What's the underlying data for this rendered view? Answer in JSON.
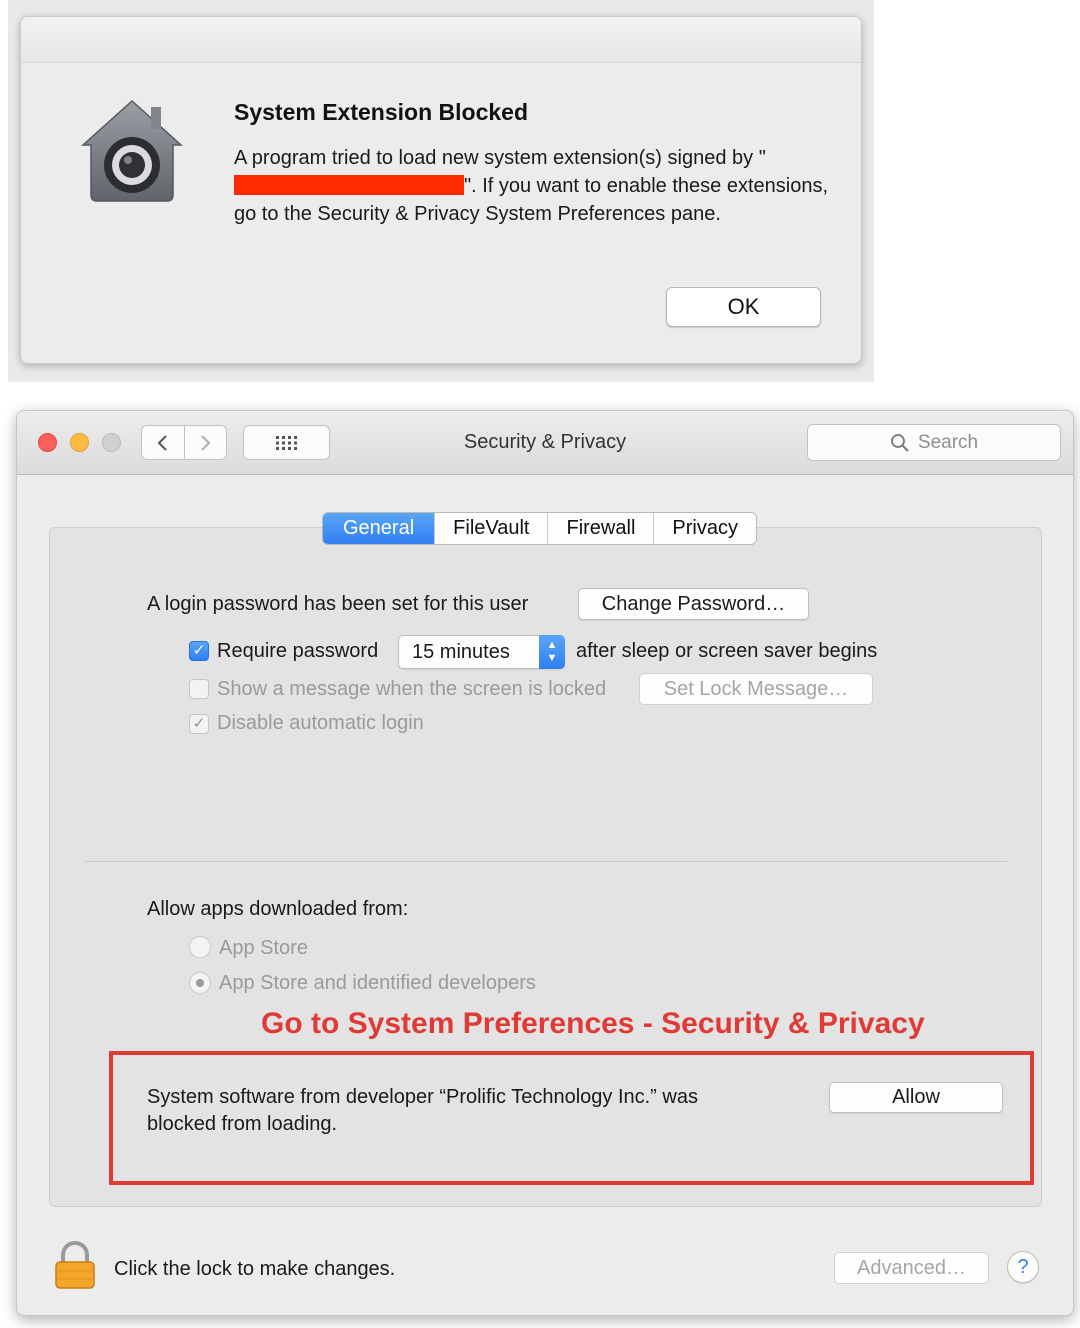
{
  "alert": {
    "title": "System Extension Blocked",
    "message_before": "A program tried to load new system extension(s) signed by \"",
    "message_after": "\".  If you want to enable these extensions, go to the Security & Privacy System Preferences pane.",
    "ok_label": "OK",
    "icon": "security-house-icon"
  },
  "window": {
    "title": "Security & Privacy",
    "search_placeholder": "Search",
    "tabs": [
      {
        "label": "General",
        "active": true
      },
      {
        "label": "FileVault",
        "active": false
      },
      {
        "label": "Firewall",
        "active": false
      },
      {
        "label": "Privacy",
        "active": false
      }
    ]
  },
  "general": {
    "login_text": "A login password has been set for this user",
    "change_password_label": "Change Password…",
    "require_password_label": "Require password",
    "require_password_checked": true,
    "require_password_delay": "15 minutes",
    "after_sleep_text": "after sleep or screen saver begins",
    "show_message_label": "Show a message when the screen is locked",
    "show_message_checked": false,
    "set_lock_message_label": "Set Lock Message…",
    "disable_autologin_label": "Disable automatic login",
    "disable_autologin_checked": true,
    "allow_apps_label": "Allow apps downloaded from:",
    "radio_app_store": "App Store",
    "radio_identified": "App Store and identified developers",
    "selected_radio": "App Store and identified developers",
    "annotation": "Go to System Preferences - Security & Privacy",
    "blocked_line1": "System software from developer “Prolific Technology Inc.” was",
    "blocked_line2": "blocked from loading.",
    "allow_label": "Allow"
  },
  "footer": {
    "lock_text": "Click the lock to make changes.",
    "advanced_label": "Advanced…",
    "help_label": "?"
  },
  "colors": {
    "accent": "#2f7ff1",
    "annotation_red": "#e03a36",
    "redaction": "#ff2a00"
  }
}
